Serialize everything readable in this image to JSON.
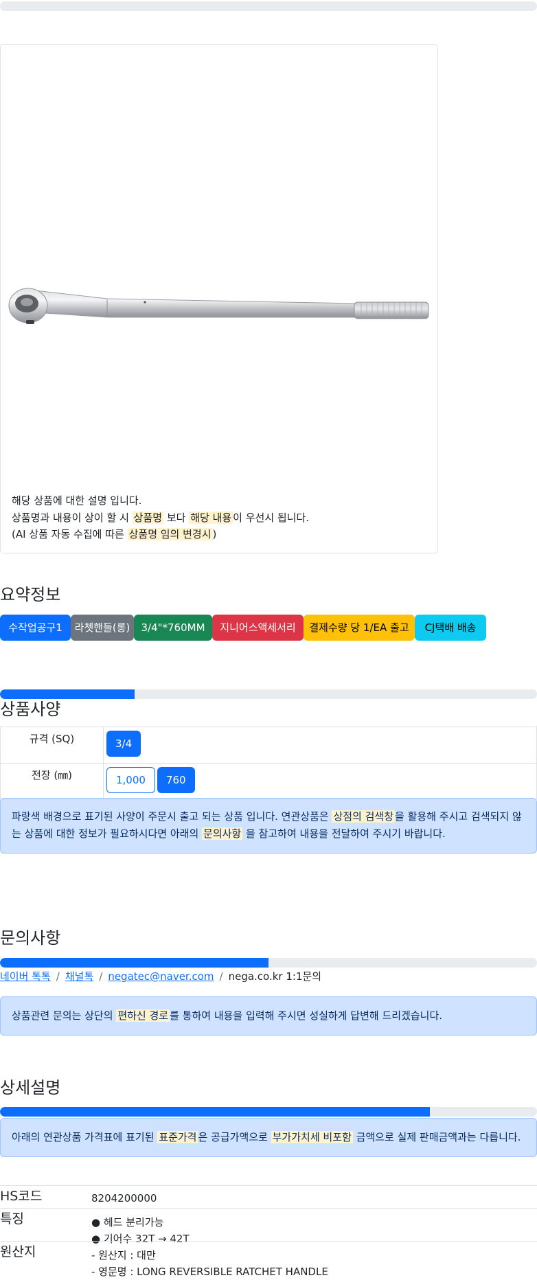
{
  "image_card": {
    "description_lines": [
      {
        "parts": [
          {
            "text": "해당 상품에 대한 설명 입니다.",
            "mark": false
          }
        ]
      },
      {
        "parts": [
          {
            "text": "상품명과 내용이 상이 할 시 ",
            "mark": false
          },
          {
            "text": "상품명",
            "mark": true
          },
          {
            "text": " 보다 ",
            "mark": false
          },
          {
            "text": "해당 내용",
            "mark": true
          },
          {
            "text": "이 우선시 됩니다.",
            "mark": false
          }
        ]
      },
      {
        "parts": [
          {
            "text": "(AI 상품 자동 수집에 따른 ",
            "mark": false
          },
          {
            "text": "상품명 임의 변경시",
            "mark": true
          },
          {
            "text": ")",
            "mark": false
          }
        ]
      }
    ]
  },
  "summary": {
    "title": "요약정보",
    "badges": [
      {
        "label": "수작업공구1",
        "color": "#0d6efd",
        "text_color": "#ffffff"
      },
      {
        "label": "라쳇핸들(롱)",
        "color": "#6c757d",
        "text_color": "#ffffff"
      },
      {
        "label": "3/4\"*760MM",
        "color": "#198754",
        "text_color": "#ffffff"
      },
      {
        "label": "지니어스액세서리",
        "color": "#dc3545",
        "text_color": "#ffffff"
      },
      {
        "label": "결제수량 당 1/EA 출고",
        "color": "#ffc107",
        "text_color": "#000000"
      },
      {
        "label": "CJ택배 배송",
        "color": "#0dcaf0",
        "text_color": "#000000"
      }
    ]
  },
  "specs": {
    "title": "상품사양",
    "progress": 0.25,
    "rows": [
      {
        "label": "규격 (SQ)",
        "options": [
          {
            "label": "3/4",
            "selected": true
          }
        ]
      },
      {
        "label": "전장 (㎜)",
        "options": [
          {
            "label": "1,000",
            "selected": false
          },
          {
            "label": "760",
            "selected": true
          }
        ]
      }
    ],
    "notice": [
      {
        "text": "파랑색 배경으로 표기된 사양이 주문시 출고 되는 상품 입니다. 연관상품은 ",
        "mark": false
      },
      {
        "text": "상점의 검색창",
        "mark": true
      },
      {
        "text": "을 활용해 주시고 검색되지 않는 상품에 대한 정보가 필요하시다면 아래의 ",
        "mark": false
      },
      {
        "text": "문의사항",
        "mark": true
      },
      {
        "text": " 을 참고하여 내용을 전달하여 주시기 바랍니다.",
        "mark": false
      }
    ]
  },
  "qna": {
    "title": "문의사항",
    "progress": 0.5,
    "links": [
      {
        "label": "네이버 톡톡",
        "link": true
      },
      {
        "label": "채널톡",
        "link": true
      },
      {
        "label": "negatec@naver.com",
        "link": true
      },
      {
        "label": "nega.co.kr 1:1문의",
        "link": false
      }
    ],
    "separator": "/",
    "notice": [
      {
        "text": "상품관련 문의는 상단의 ",
        "mark": false
      },
      {
        "text": "편하신 경로",
        "mark": true
      },
      {
        "text": "를 통하여 내용을 입력해 주시면 성실하게 답변해 드리겠습니다.",
        "mark": false
      }
    ]
  },
  "detail": {
    "title": "상세설명",
    "progress": 0.8,
    "notice": [
      {
        "text": "아래의 연관상품 가격표에 표기된 ",
        "mark": false
      },
      {
        "text": "표준가격",
        "mark": true
      },
      {
        "text": "은 공급가액으로 ",
        "mark": false
      },
      {
        "text": "부가가치세 비포함",
        "mark": true
      },
      {
        "text": " 금액으로 실제 판매금액과는 다릅니다.",
        "mark": false
      }
    ],
    "info": [
      {
        "key": "HS코드",
        "values": [
          "8204200000"
        ]
      },
      {
        "key": "특징",
        "values": [
          "● 헤드 분리가능",
          "● 기어수 32T → 42T"
        ]
      },
      {
        "key": "원산지",
        "values": [
          "- 원산지 : 대만",
          "- 영문명 : LONG REVERSIBLE RATCHET HANDLE"
        ]
      }
    ]
  }
}
